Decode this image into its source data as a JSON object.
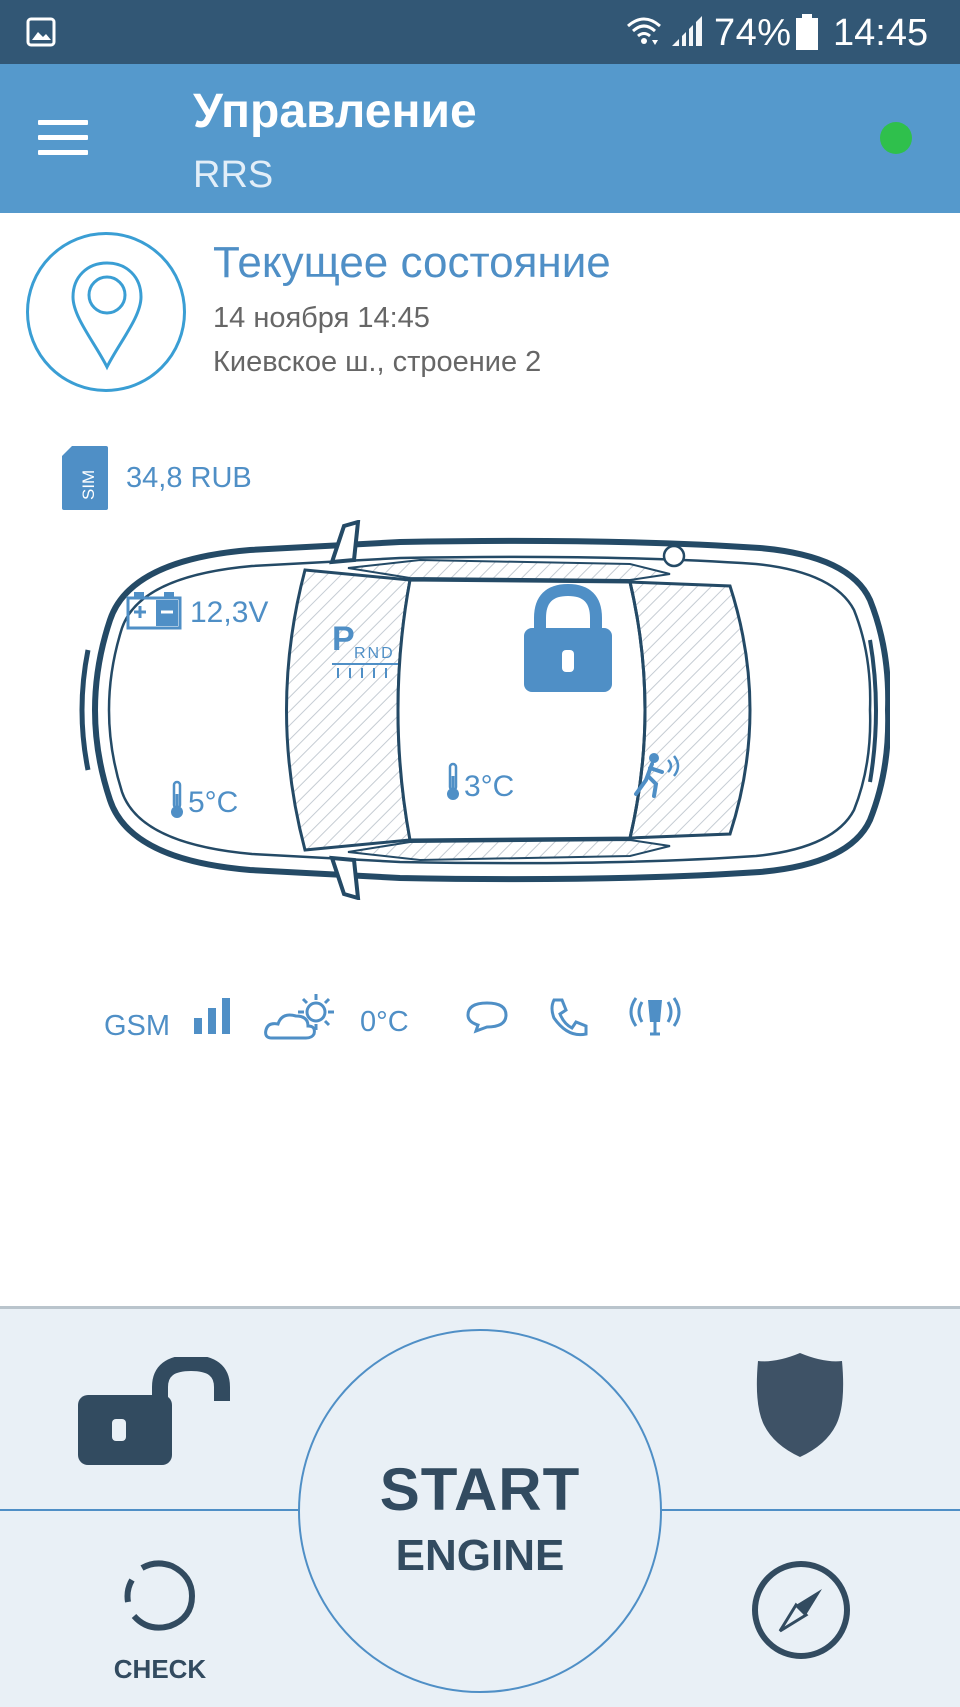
{
  "status_bar": {
    "battery": "74%",
    "time": "14:45",
    "icons": [
      "gallery-icon",
      "wifi-icon",
      "signal-icon",
      "battery-icon"
    ]
  },
  "app_bar": {
    "title": "Управление",
    "subtitle": "RRS",
    "connection_color": "#2fc04c"
  },
  "current_state": {
    "title": "Текущее состояние",
    "date": "14 ноября 14:45",
    "address": "Киевское ш., строение 2"
  },
  "sim": {
    "label": "SIM",
    "balance": "34,8 RUB"
  },
  "car": {
    "battery_voltage": "12,3V",
    "engine_temp": "5°C",
    "cabin_temp": "3°C",
    "gearbox": {
      "letter": "P",
      "positions": "RND"
    },
    "locked": true
  },
  "info": {
    "gsm_label": "GSM",
    "outside_temp": "0°C",
    "icons": [
      "signal-bars-icon",
      "weather-icon",
      "sms-icon",
      "phone-icon",
      "alarm-icon"
    ]
  },
  "controls": {
    "start_line1": "START",
    "start_line2": "ENGINE",
    "check_label": "CHECK",
    "icons": [
      "unlock-icon",
      "shield-icon",
      "check-icon",
      "compass-icon"
    ]
  },
  "colors": {
    "status_bar": "#325775",
    "app_bar": "#5599cc",
    "accent": "#4f8fc6",
    "dark": "#324b60",
    "panel_bg": "#e9f0f6"
  }
}
